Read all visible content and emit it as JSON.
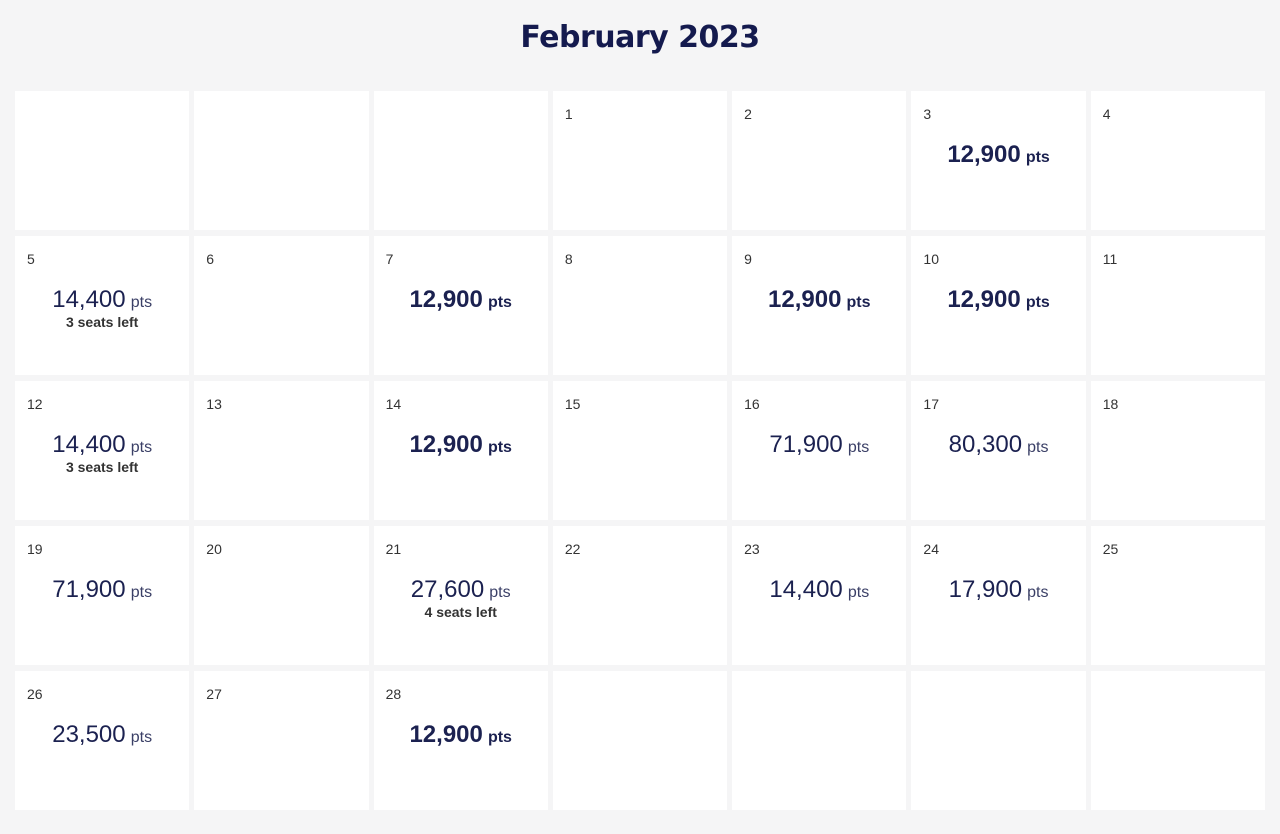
{
  "title": "February 2023",
  "unit_label": "pts",
  "colors": {
    "title": "#141a4e",
    "price": "#1b2150",
    "background": "#f5f5f6",
    "cell": "#ffffff"
  },
  "leading_blanks": 3,
  "trailing_blanks": 4,
  "days": [
    {
      "day": "1"
    },
    {
      "day": "2"
    },
    {
      "day": "3",
      "points": "12,900",
      "lowest": true
    },
    {
      "day": "4"
    },
    {
      "day": "5",
      "points": "14,400",
      "seats": "3 seats left"
    },
    {
      "day": "6"
    },
    {
      "day": "7",
      "points": "12,900",
      "lowest": true
    },
    {
      "day": "8"
    },
    {
      "day": "9",
      "points": "12,900",
      "lowest": true
    },
    {
      "day": "10",
      "points": "12,900",
      "lowest": true
    },
    {
      "day": "11"
    },
    {
      "day": "12",
      "points": "14,400",
      "seats": "3 seats left"
    },
    {
      "day": "13"
    },
    {
      "day": "14",
      "points": "12,900",
      "lowest": true
    },
    {
      "day": "15"
    },
    {
      "day": "16",
      "points": "71,900"
    },
    {
      "day": "17",
      "points": "80,300"
    },
    {
      "day": "18"
    },
    {
      "day": "19",
      "points": "71,900"
    },
    {
      "day": "20"
    },
    {
      "day": "21",
      "points": "27,600",
      "seats": "4 seats left"
    },
    {
      "day": "22"
    },
    {
      "day": "23",
      "points": "14,400"
    },
    {
      "day": "24",
      "points": "17,900"
    },
    {
      "day": "25"
    },
    {
      "day": "26",
      "points": "23,500"
    },
    {
      "day": "27"
    },
    {
      "day": "28",
      "points": "12,900",
      "lowest": true
    }
  ]
}
